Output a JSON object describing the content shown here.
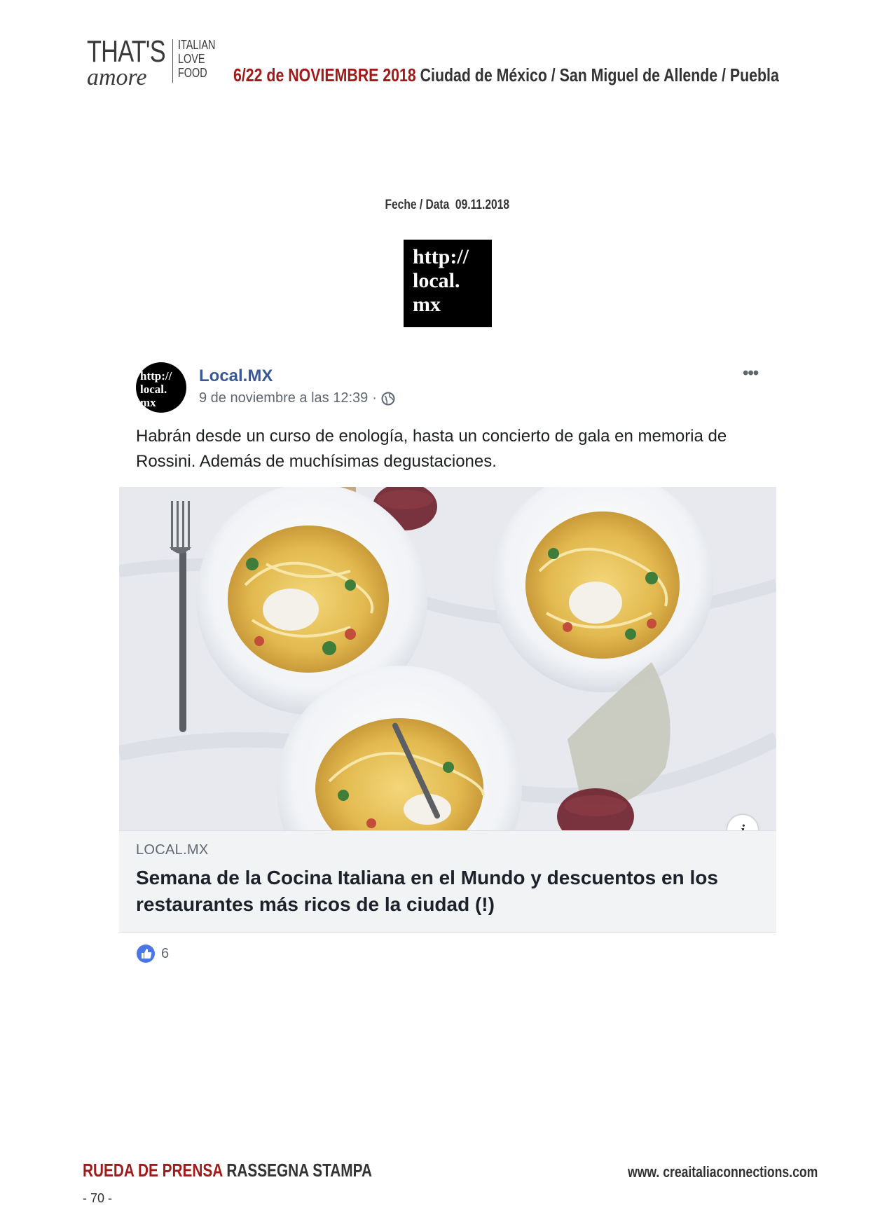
{
  "header": {
    "brand_main": "THAT'S",
    "brand_script": "amore",
    "brand_words": [
      "ITALIAN",
      "LOVE",
      "FOOD"
    ],
    "dates": "6/22 de NOVIEMBRE 2018",
    "cities": "Ciudad de México / San Miguel de Allende / Puebla"
  },
  "date_line": "Feche / Data  09.11.2018",
  "source_logo": [
    "http://",
    "local.",
    "mx"
  ],
  "post": {
    "avatar_lines": [
      "http://",
      "local.",
      "mx"
    ],
    "page_name": "Local.MX",
    "timestamp": "9 de noviembre a las 12:39",
    "separator": "·",
    "menu": "•••",
    "text": "Habrán desde un curso de enología, hasta un concierto de gala en memoria de Rossini. Además de muchísimas degustaciones.",
    "link_domain": "LOCAL.MX",
    "link_title": "Semana de la Cocina Italiana en el Mundo y descuentos en los restaurantes más ricos de la ciudad (!)",
    "info": "i",
    "like_count": "6",
    "icons": [
      "globe-icon",
      "info-icon",
      "like-icon"
    ]
  },
  "footer": {
    "label_red": "RUEDA DE PRENSA",
    "label_gray": "RASSEGNA STAMPA",
    "page_number": "- 70 -",
    "url": "www. creaitaliaconnections.com"
  },
  "colors": {
    "accent_red": "#a11a1a",
    "facebook_blue": "#385898",
    "link_box_bg": "#f2f3f5"
  }
}
